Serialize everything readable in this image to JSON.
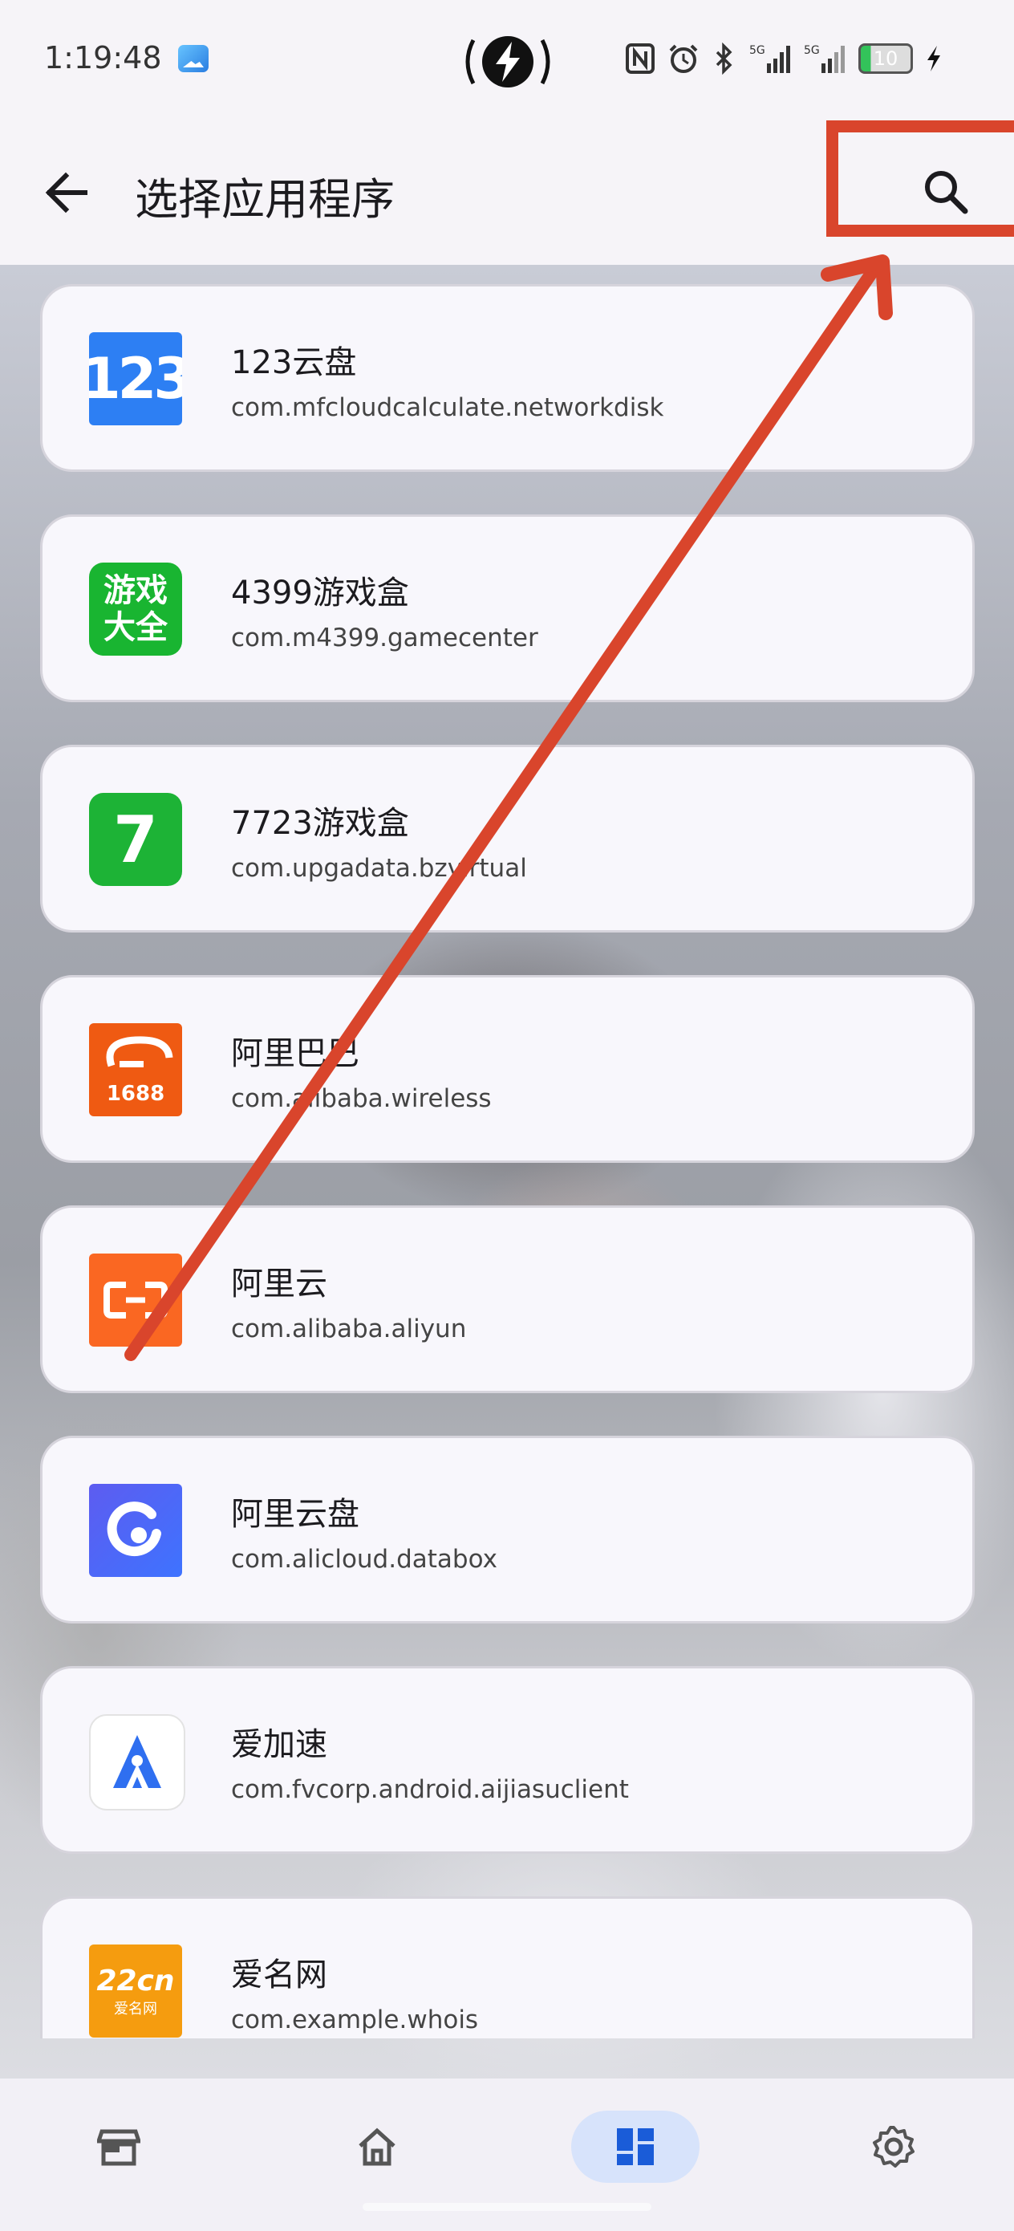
{
  "status": {
    "time": "1:19:48",
    "battery": "10",
    "icons": [
      "gallery-icon",
      "flash-icon",
      "nfc-icon",
      "alarm-icon",
      "bluetooth-icon",
      "signal-5g-icon",
      "signal-5g-icon",
      "battery-icon",
      "charging-icon"
    ]
  },
  "appbar": {
    "title": "选择应用程序"
  },
  "apps": [
    {
      "name": "123云盘",
      "package": "com.mfcloudcalculate.networkdisk",
      "icon": "123-cloud-icon",
      "badge": "123"
    },
    {
      "name": "4399游戏盒",
      "package": "com.m4399.gamecenter",
      "icon": "4399-game-icon",
      "badge": "游戏大全"
    },
    {
      "name": "7723游戏盒",
      "package": "com.upgadata.bzvirtual",
      "icon": "7723-game-icon",
      "badge": "7"
    },
    {
      "name": "阿里巴巴",
      "package": "com.alibaba.wireless",
      "icon": "alibaba-1688-icon",
      "badge": "1688"
    },
    {
      "name": "阿里云",
      "package": "com.alibaba.aliyun",
      "icon": "aliyun-icon",
      "badge": "[-]"
    },
    {
      "name": "阿里云盘",
      "package": "com.alicloud.databox",
      "icon": "alicloud-disk-icon",
      "badge": ""
    },
    {
      "name": "爱加速",
      "package": "com.fvcorp.android.aijiasuclient",
      "icon": "aijiasu-icon",
      "badge": ""
    },
    {
      "name": "爱名网",
      "package": "com.example.whois",
      "icon": "aiming-icon",
      "badge": "22cn",
      "badge_sub": "爱名网"
    }
  ],
  "bottom_nav": [
    {
      "icon": "store-icon",
      "active": false
    },
    {
      "icon": "home-icon",
      "active": false
    },
    {
      "icon": "dashboard-icon",
      "active": true
    },
    {
      "icon": "settings-icon",
      "active": false
    }
  ],
  "colors": {
    "annotation_red": "#d9452c",
    "nav_active": "#d7e3fb",
    "nav_active_icon": "#1a5cd8"
  }
}
